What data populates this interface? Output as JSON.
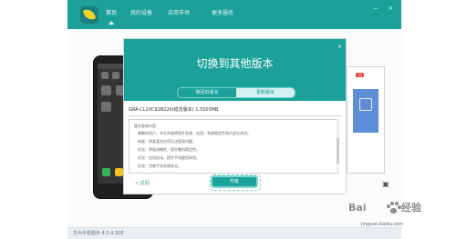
{
  "header": {
    "nav": [
      {
        "label": "首页"
      },
      {
        "label": "我的设备"
      },
      {
        "label": "应用市场"
      },
      {
        "label": "更多服务"
      }
    ],
    "window_controls": {
      "minimize": "—",
      "close": "✕"
    }
  },
  "dialog": {
    "title": "切换到其他版本",
    "tabs": [
      {
        "label": "降回旧版本",
        "selected": false
      },
      {
        "label": "更新版本",
        "selected": true
      }
    ],
    "selected_version": "GRA-CL10C92B220(稳定版本) 1.5503MB",
    "release_notes_heading": "版本更新内容",
    "release_notes": [
      "尊敬的用户，本次升级将提升系统、应用、系统稳定性和大部分改进。",
      "修复：修复某些应用无法登录问题。",
      "优化：界面流畅性，提升整机稳定性。",
      "优化：应用启动，提升手机使用体验。",
      "优化：完善手机系统安全。"
    ],
    "back_label": "< 返回",
    "confirm_label": "升级",
    "close_icon_label": "✕"
  },
  "status_bar": {
    "version": "华为手机助手 4.0.4.308"
  },
  "background": {
    "badge_count": "10"
  },
  "watermark": {
    "left_text": "Bai",
    "right_text": "经验",
    "bottom_text": "jingyan.baidu.com"
  },
  "colors": {
    "primary": "#1ba199",
    "primary_dark": "#168f8a",
    "text_dark": "#333333",
    "text_muted": "#666666",
    "badge_red": "#df3838"
  },
  "icons": {
    "logo": "app-logo-icon",
    "paw": "baidu-paw-icon",
    "device_side": "shield-icon"
  }
}
